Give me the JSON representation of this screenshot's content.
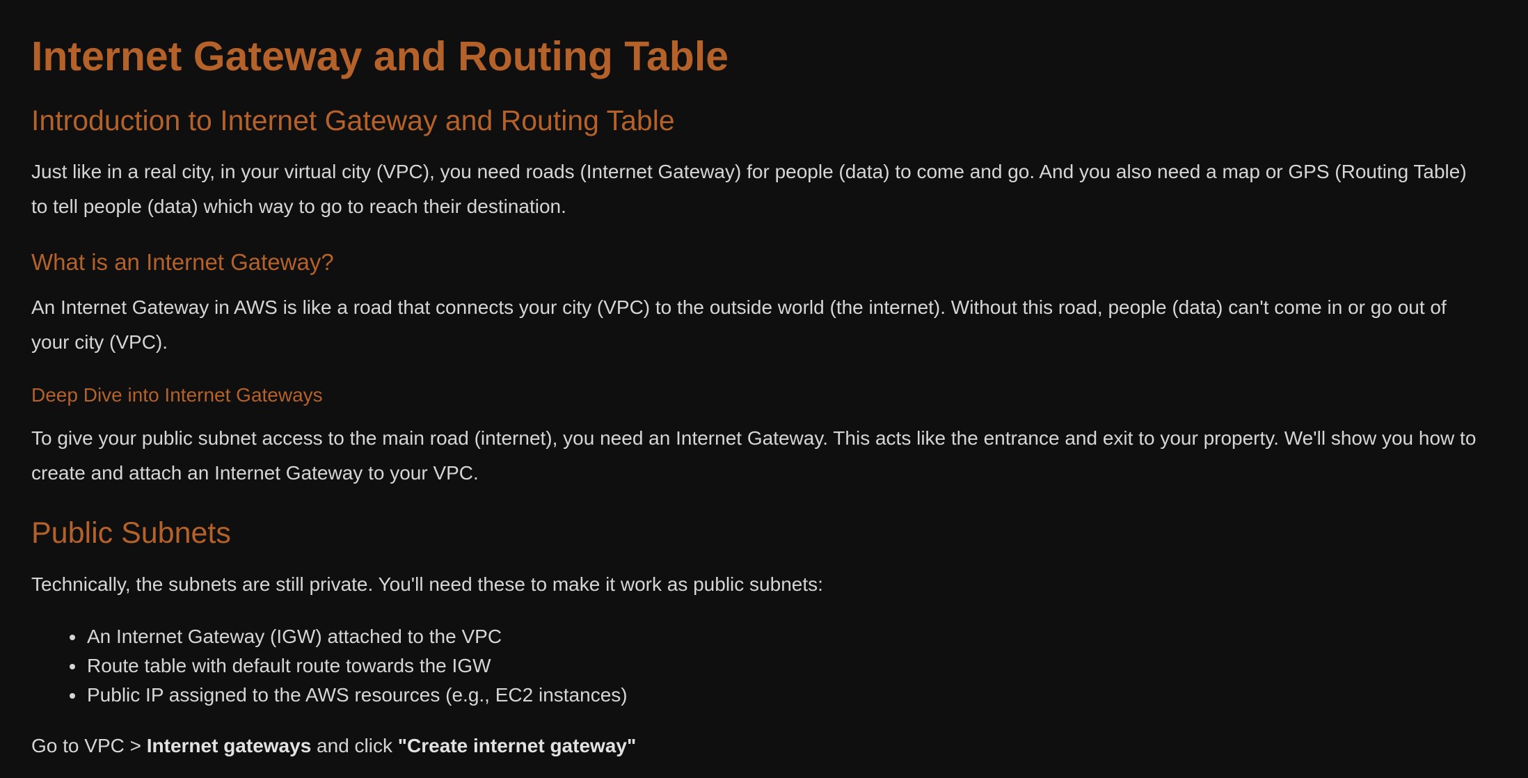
{
  "title": "Internet Gateway and Routing Table",
  "intro": {
    "heading": "Introduction to Internet Gateway and Routing Table",
    "text": "Just like in a real city, in your virtual city (VPC), you need roads (Internet Gateway) for people (data) to come and go. And you also need a map or GPS (Routing Table) to tell people (data) which way to go to reach their destination."
  },
  "what_is": {
    "heading": "What is an Internet Gateway?",
    "text": "An Internet Gateway in AWS is like a road that connects your city (VPC) to the outside world (the internet). Without this road, people (data) can't come in or go out of your city (VPC)."
  },
  "deep_dive": {
    "heading": "Deep Dive into Internet Gateways",
    "text": "To give your public subnet access to the main road (internet), you need an Internet Gateway. This acts like the entrance and exit to your property. We'll show you how to create and attach an Internet Gateway to your VPC."
  },
  "public_subnets": {
    "heading": "Public Subnets",
    "text": "Technically, the subnets are still private. You'll need these to make it work as public subnets:",
    "items": [
      "An Internet Gateway (IGW) attached to the VPC",
      "Route table with default route towards the IGW",
      "Public IP assigned to the AWS resources (e.g., EC2 instances)"
    ],
    "instruction": {
      "prefix": "Go to VPC > ",
      "bold1": "Internet gateways",
      "middle": " and click ",
      "bold2": "\"Create internet gateway\""
    }
  },
  "colors": {
    "background": "#0f0f0f",
    "heading": "#b5612a",
    "text": "#d6d6d6"
  }
}
